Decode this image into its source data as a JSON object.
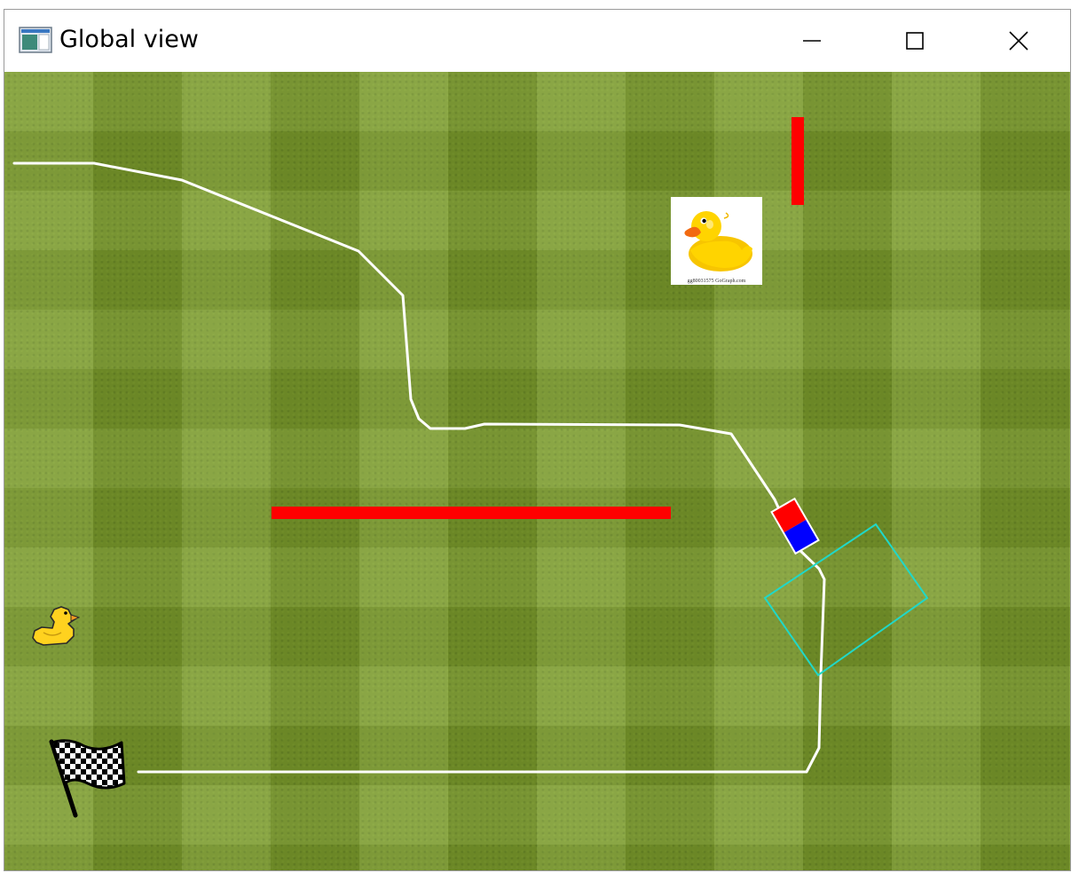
{
  "window": {
    "title": "Global view",
    "icon": "app-window-icon",
    "controls": {
      "minimize_icon": "minimize-icon",
      "maximize_icon": "maximize-icon",
      "close_icon": "close-icon"
    }
  },
  "scene": {
    "background": "grass-field",
    "obstacle_color": "#ff0000",
    "path_color": "#ffffff",
    "sensor_color": "#20d8c8",
    "robot": {
      "front_color": "#ff0000",
      "rear_color": "#0000ff"
    },
    "goal_icon": "checkered-flag-icon",
    "start_icon": "duck-icon",
    "target_photo": {
      "icon": "rubber-duck-photo",
      "credit_text": "gg80031575 GoGraph.com"
    }
  }
}
